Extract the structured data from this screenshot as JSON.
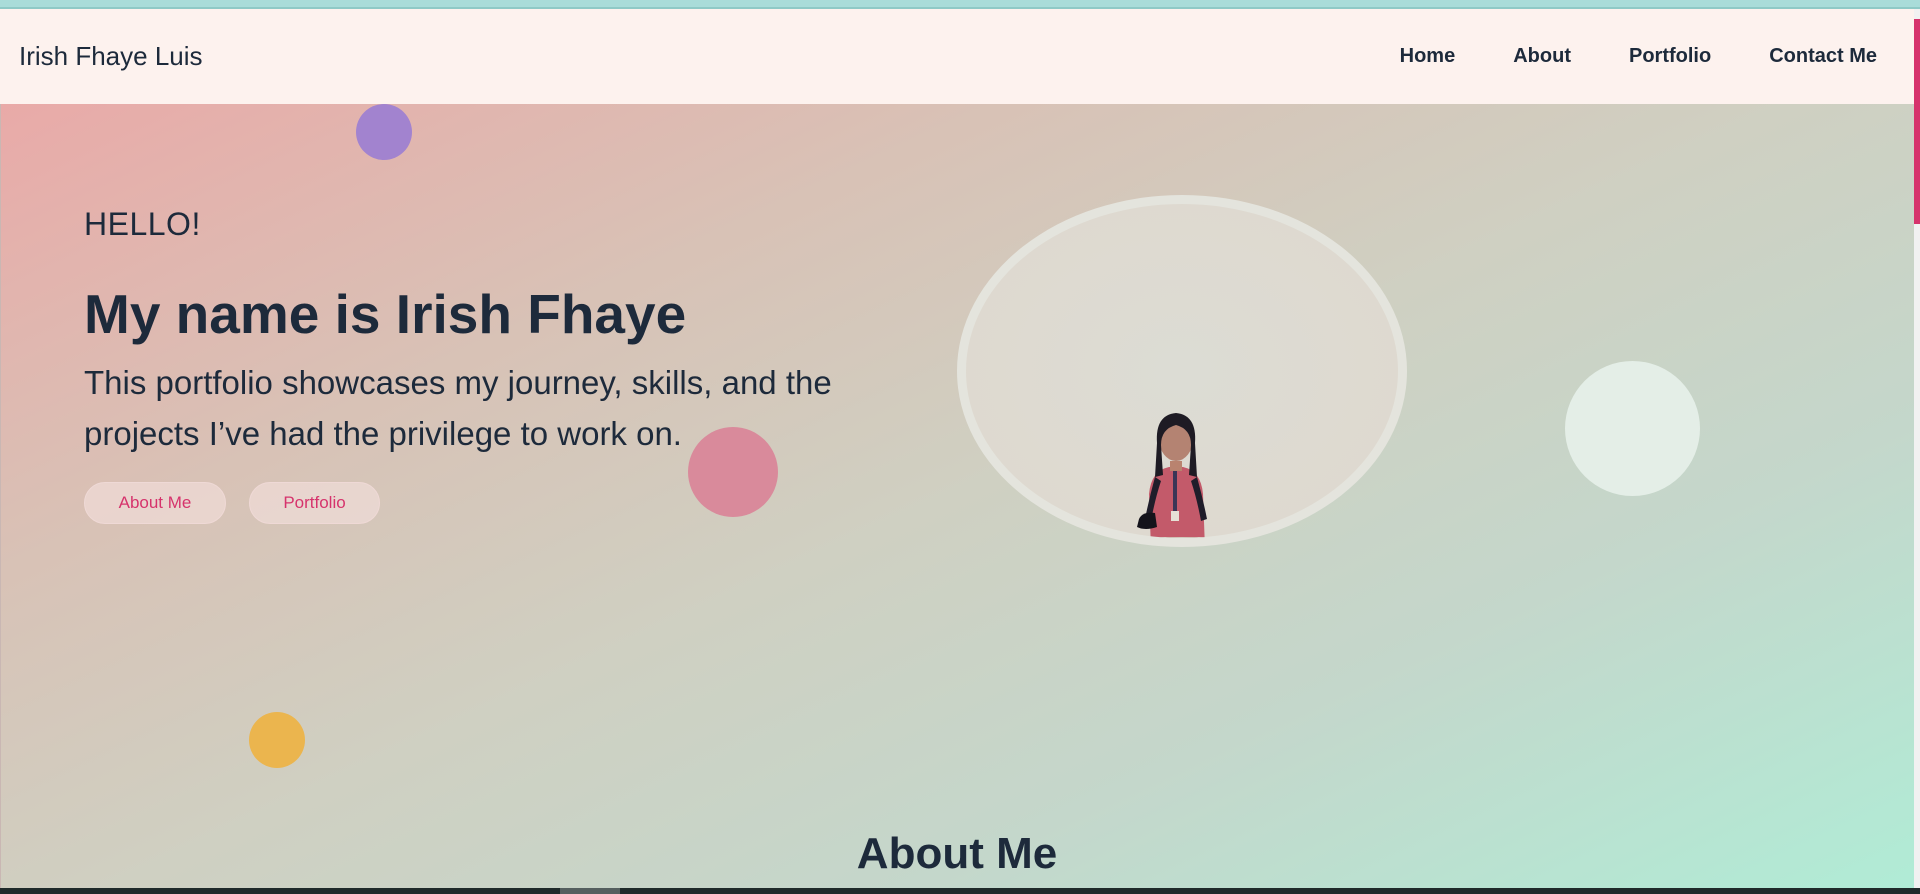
{
  "brand": "Irish Fhaye Luis",
  "nav": {
    "items": [
      "Home",
      "About",
      "Portfolio",
      "Contact Me"
    ]
  },
  "hero": {
    "greeting": "HELLO!",
    "headline": "My name is Irish Fhaye",
    "description": "This portfolio showcases my journey, skills, and the projects I’ve had the privilege to work on.",
    "buttons": {
      "about": "About Me",
      "portfolio": "Portfolio"
    }
  },
  "sections": {
    "about_title": "About Me"
  },
  "colors": {
    "accent": "#d6336c",
    "text": "#1d2a3b",
    "navbar_bg": "#fdf2ee",
    "dot_purple": "#a283cf",
    "dot_pink": "#d98a9b",
    "dot_yellow": "#ebb54e",
    "dot_mint": "#e4eee7"
  }
}
